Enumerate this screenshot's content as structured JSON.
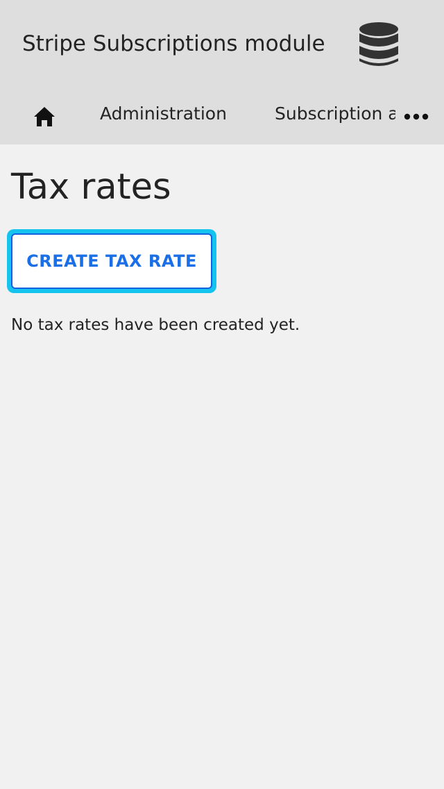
{
  "header": {
    "app_title": "Stripe Subscriptions module",
    "icon": "database-icon"
  },
  "nav": {
    "home_icon": "home-icon",
    "items": [
      {
        "label": "Administration"
      },
      {
        "label": "Subscription and tax"
      }
    ],
    "more_icon": "more-horizontal-icon"
  },
  "main": {
    "title": "Tax rates",
    "create_button_label": "CREATE TAX RATE",
    "empty_message": "No tax rates have been created yet."
  },
  "colors": {
    "header_bg": "#dedede",
    "page_bg": "#f1f1f1",
    "primary": "#1a6fe6",
    "focus_ring": "#14c3ee"
  }
}
